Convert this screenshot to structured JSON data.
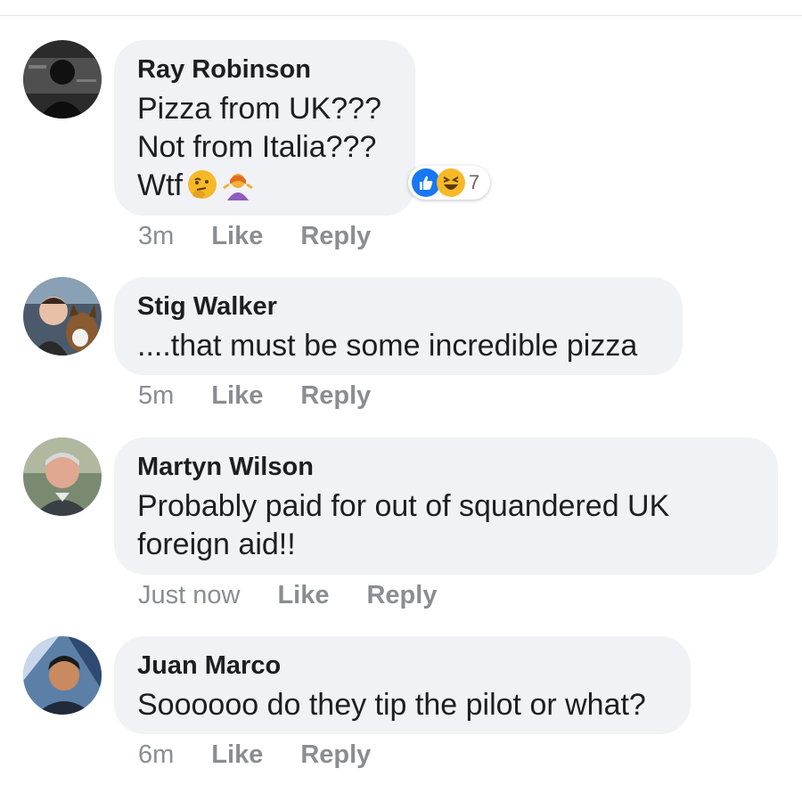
{
  "comments": [
    {
      "author": "Ray Robinson",
      "lines": [
        "Pizza from UK???",
        "Not from Italia???",
        "Wtf"
      ],
      "emojis": [
        "thinking-face-icon",
        "person-shrugging-icon"
      ],
      "time": "3m",
      "like_label": "Like",
      "reply_label": "Reply",
      "reactions": {
        "types": [
          "like-icon",
          "haha-icon"
        ],
        "count": "7"
      }
    },
    {
      "author": "Stig Walker",
      "lines": [
        "....that must be some incredible pizza"
      ],
      "time": "5m",
      "like_label": "Like",
      "reply_label": "Reply"
    },
    {
      "author": "Martyn Wilson",
      "lines": [
        "Probably paid for out of squandered UK",
        "foreign aid!!"
      ],
      "time": "Just now",
      "like_label": "Like",
      "reply_label": "Reply"
    },
    {
      "author": "Juan Marco",
      "lines": [
        "Soooooo do they tip the pilot or what?"
      ],
      "time": "6m",
      "like_label": "Like",
      "reply_label": "Reply"
    }
  ],
  "colors": {
    "bubble": "#f0f2f5",
    "meta_text": "#8a8d91",
    "like_blue": "#1877f2",
    "haha_yellow": "#f7b928"
  }
}
